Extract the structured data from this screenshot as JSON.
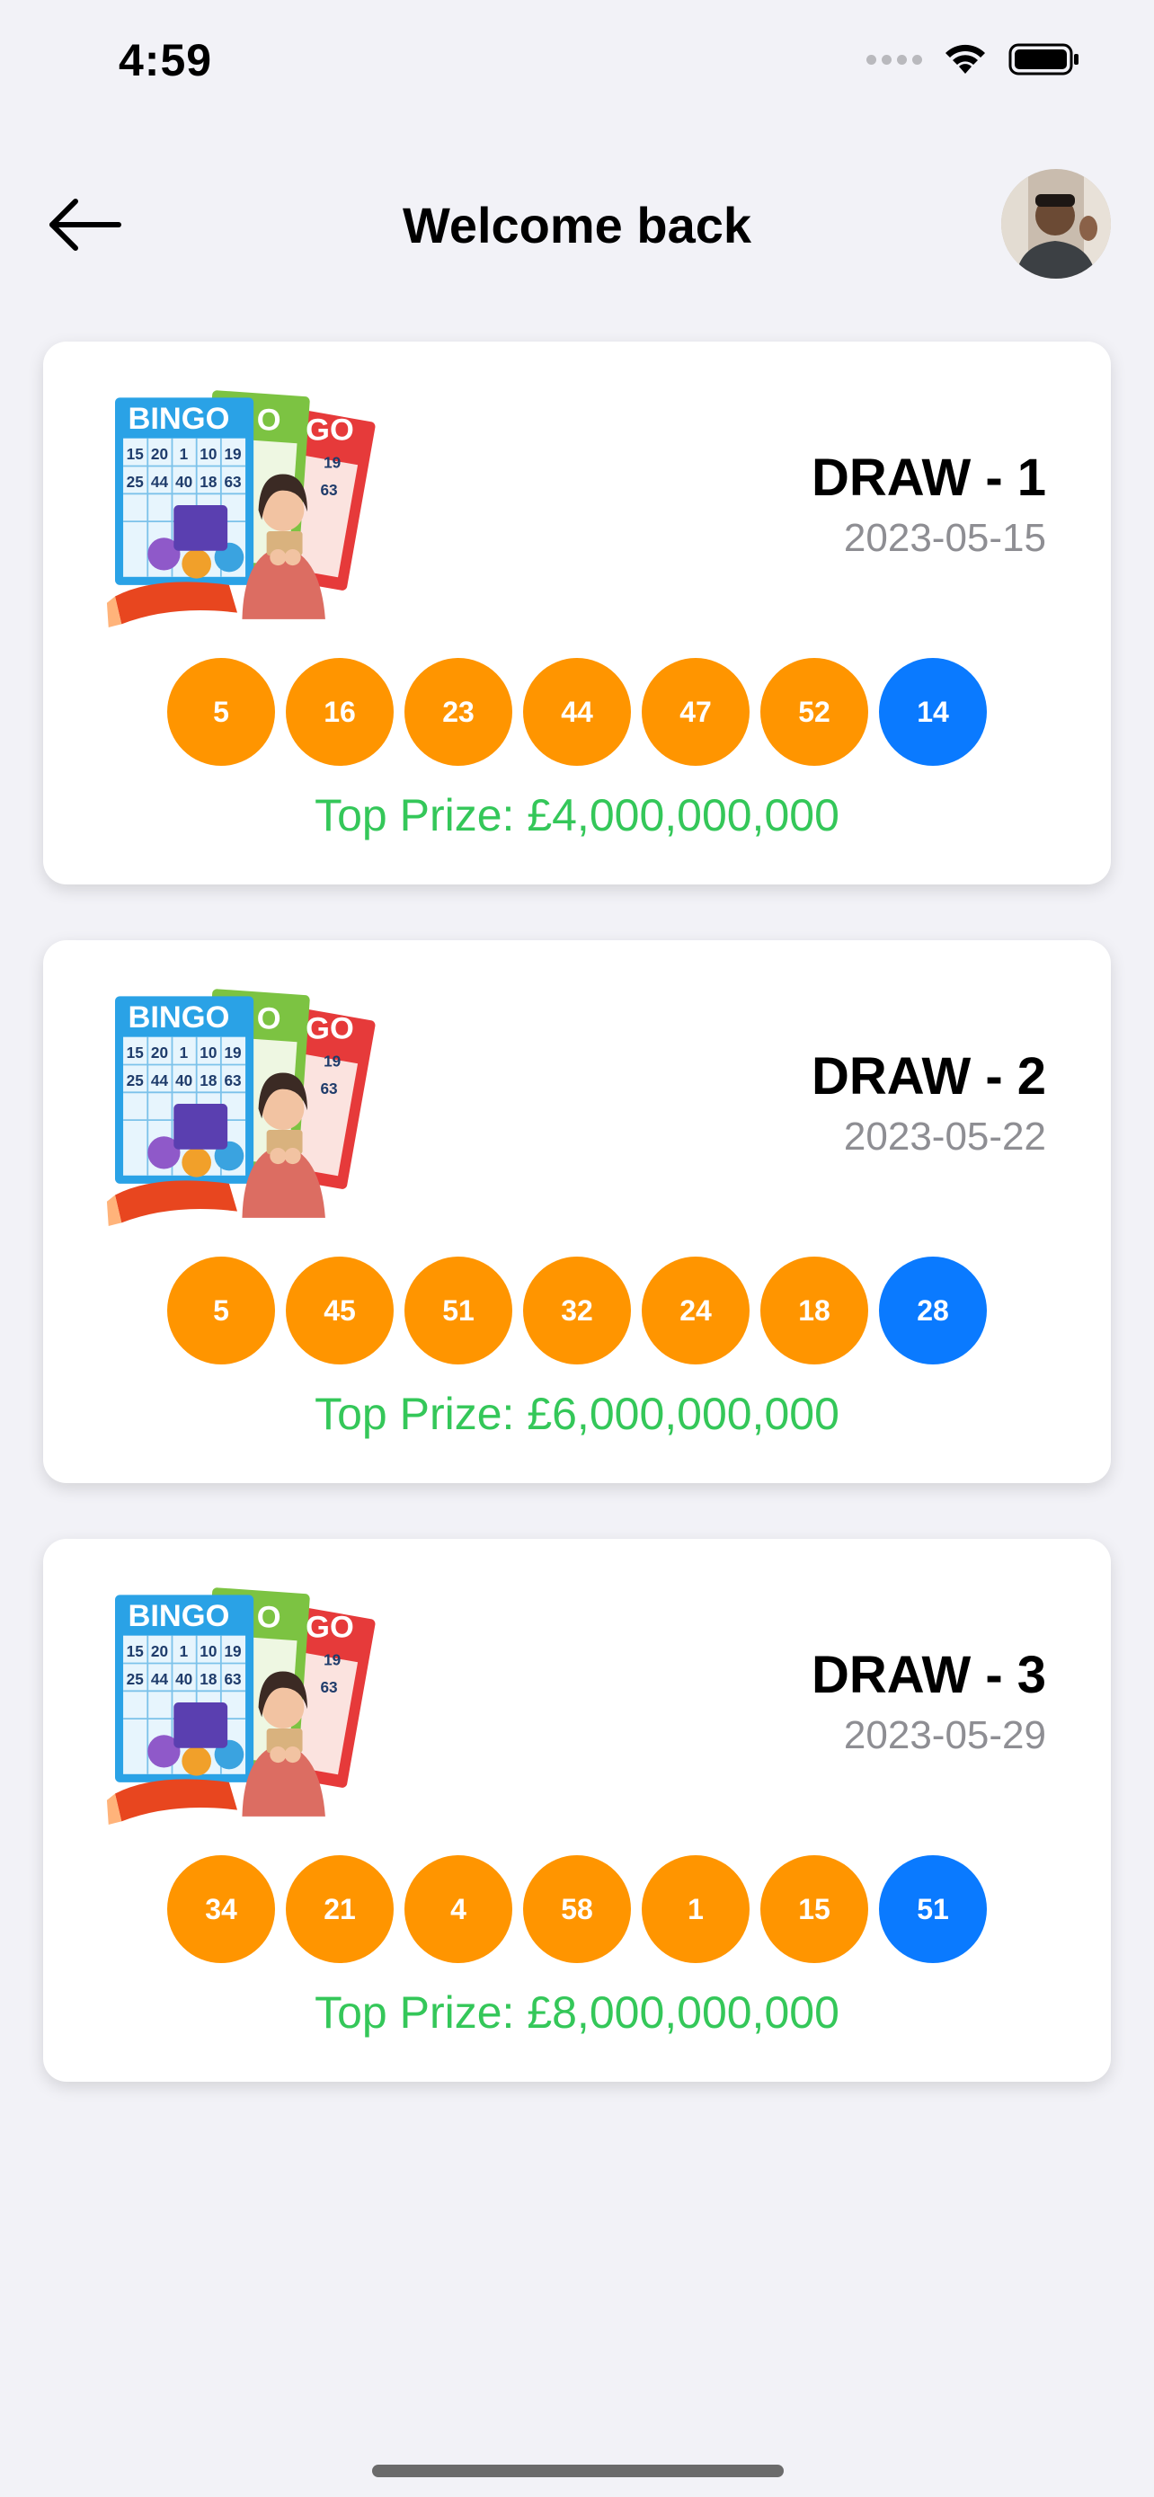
{
  "status_bar": {
    "time": "4:59"
  },
  "nav": {
    "title": "Welcome back"
  },
  "draws": [
    {
      "title": "DRAW - 1",
      "date": "2023-05-15",
      "numbers": [
        "5",
        "16",
        "23",
        "44",
        "47",
        "52"
      ],
      "bonus": "14",
      "prize": "Top Prize: £4,000,000,000"
    },
    {
      "title": "DRAW - 2",
      "date": "2023-05-22",
      "numbers": [
        "5",
        "45",
        "51",
        "32",
        "24",
        "18"
      ],
      "bonus": "28",
      "prize": "Top Prize: £6,000,000,000"
    },
    {
      "title": "DRAW - 3",
      "date": "2023-05-29",
      "numbers": [
        "34",
        "21",
        "4",
        "58",
        "1",
        "15"
      ],
      "bonus": "51",
      "prize": "Top Prize: £8,000,000,000"
    }
  ],
  "art": {
    "ticket_title": "BINGO",
    "ticket_behind_1": "O",
    "ticket_behind_2": "GO",
    "ticket_numbers": [
      "15",
      "20",
      "1",
      "10",
      "19",
      "25",
      "44",
      "40",
      "18",
      "63"
    ],
    "ticket_behind_numbers": [
      "19",
      "63"
    ]
  },
  "colors": {
    "ball": "#ff9500",
    "bonus": "#0a7aff",
    "prize": "#34c759",
    "date": "#8e8e93"
  }
}
